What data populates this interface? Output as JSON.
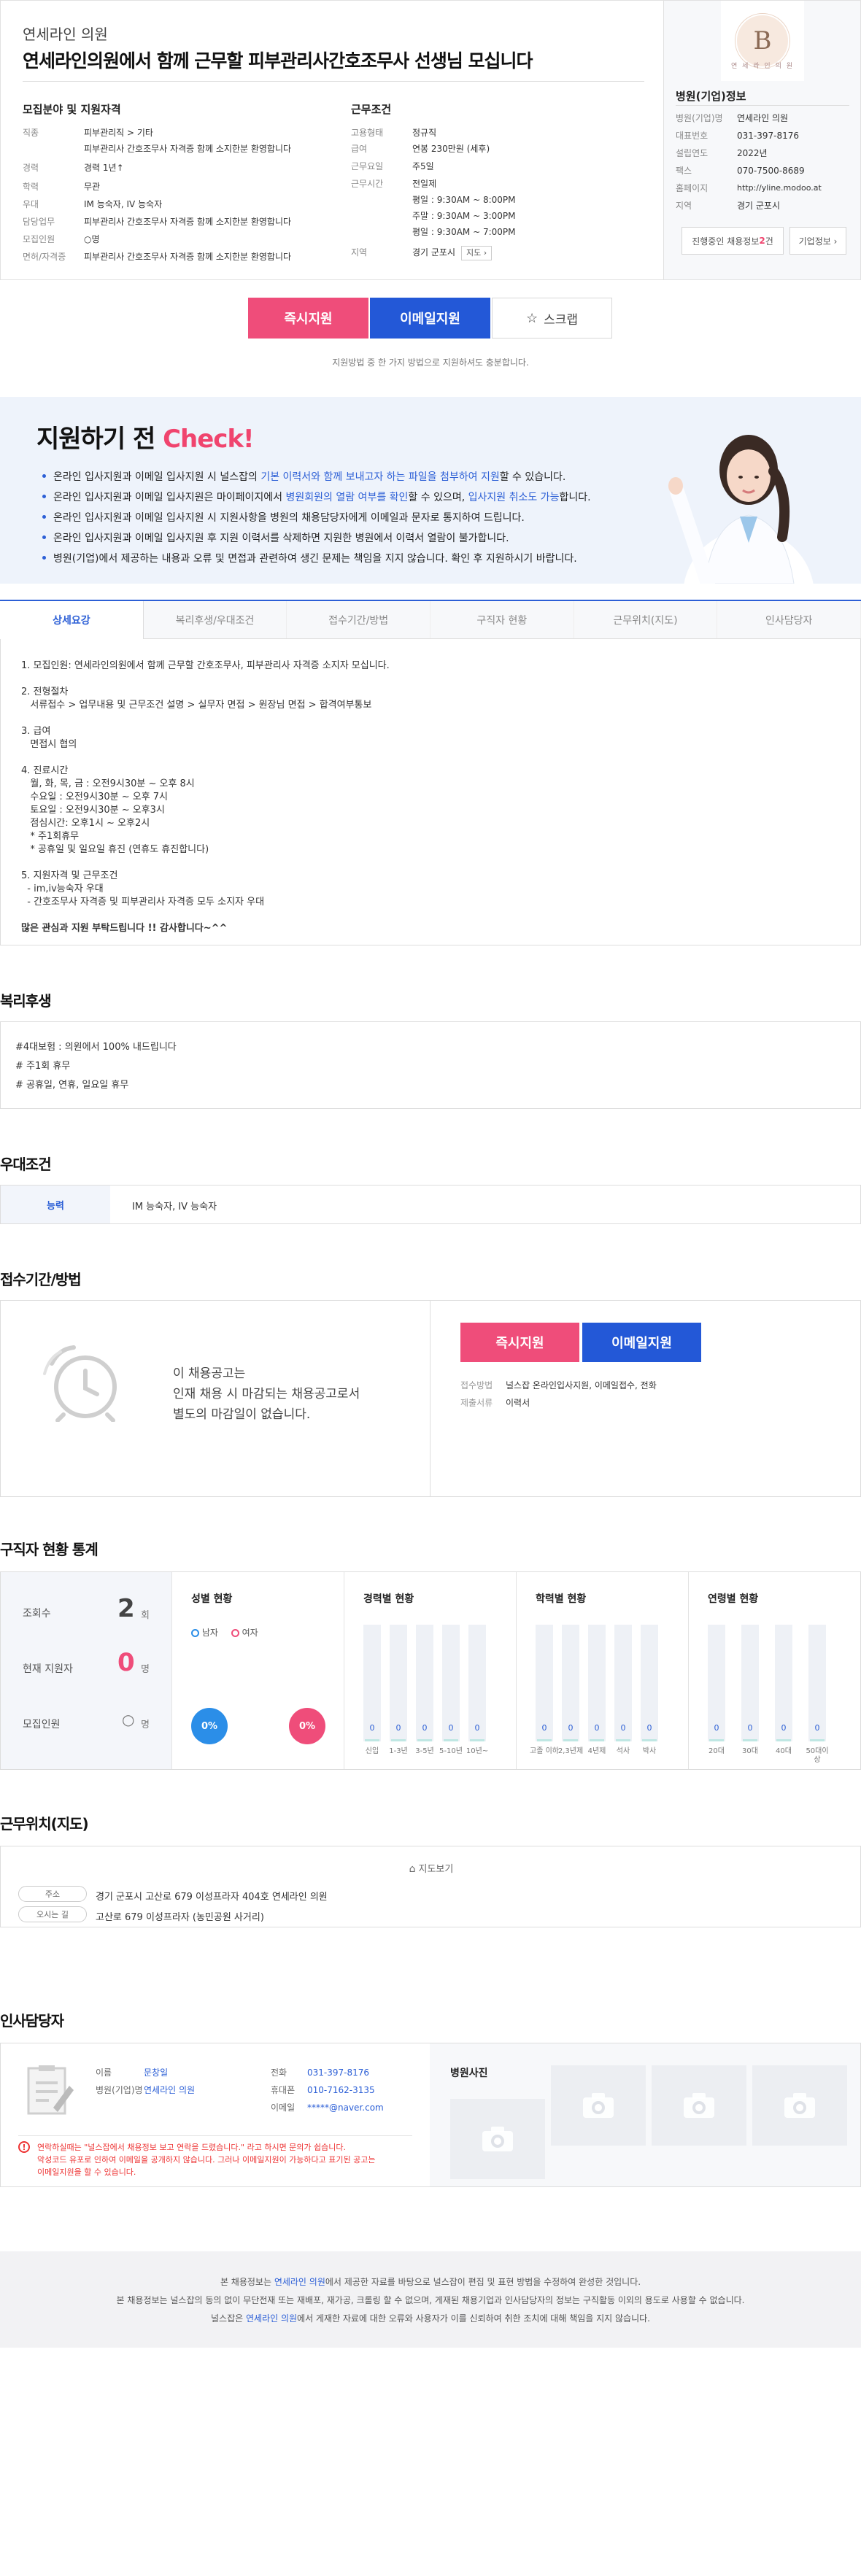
{
  "header": {
    "company": "연세라인 의원",
    "title": "연세라인의원에서 함께 근무할 피부관리사간호조무사 선생님 모십니다"
  },
  "req": {
    "heading": "모집분야 및 지원자격",
    "rows": [
      {
        "k": "직종",
        "v": "피부관리직 > 기타"
      },
      {
        "k": "",
        "v": "피부관리사 간호조무사 자격증 함께 소지한분 환영합니다"
      },
      {
        "k": "경력",
        "v": "경력 1년↑"
      },
      {
        "k": "학력",
        "v": "무관"
      },
      {
        "k": "우대",
        "v": "IM 능숙자, IV 능숙자"
      },
      {
        "k": "담당업무",
        "v": "피부관리사 간호조무사 자격증 함께 소지한분 환영합니다"
      },
      {
        "k": "모집인원",
        "v": "○명"
      },
      {
        "k": "면허/자격증",
        "v": "피부관리사 간호조무사 자격증 함께 소지한분 환영합니다"
      }
    ]
  },
  "cond": {
    "heading": "근무조건",
    "rows": [
      {
        "k": "고용형태",
        "v": "정규직"
      },
      {
        "k": "급여",
        "v": "연봉 230만원 (세후)"
      },
      {
        "k": "근무요일",
        "v": "주5일"
      },
      {
        "k": "근무시간",
        "v": "전일제"
      },
      {
        "k": "",
        "v": "평일 : 9:30AM ~ 8:00PM"
      },
      {
        "k": "",
        "v": "주말 : 9:30AM ~ 3:00PM"
      },
      {
        "k": "",
        "v": "평일 : 9:30AM ~ 7:00PM"
      }
    ],
    "location_label": "지역",
    "location": "경기 군포시",
    "map_btn": "지도 ›"
  },
  "hospital": {
    "logo_letter": "B",
    "logo_sub": "연 세 라 인 의 원",
    "heading": "병원(기업)정보",
    "rows": [
      {
        "k": "병원(기업)명",
        "v": "연세라인 의원"
      },
      {
        "k": "대표번호",
        "v": "031-397-8176"
      },
      {
        "k": "설립연도",
        "v": "2022년"
      },
      {
        "k": "팩스",
        "v": "070-7500-8689"
      },
      {
        "k": "홈페이지",
        "v": "http://yline.modoo.at"
      },
      {
        "k": "지역",
        "v": "경기 군포시"
      }
    ],
    "btn_jobs_pre": "진행중인 채용정보 ",
    "btn_jobs_count": "2",
    "btn_jobs_post": "건",
    "btn_company": "기업정보 ›"
  },
  "apply": {
    "now": "즉시지원",
    "email": "이메일지원",
    "scrap": "스크랩",
    "note": "지원방법 중 한 가지 방법으로 지원하셔도 충분합니다."
  },
  "check": {
    "title_pre": "지원하기 전 ",
    "title_hl": "Check!",
    "items": [
      {
        "a": "온라인 입사지원과 이메일 입사지원 시 널스잡의 ",
        "b": "기본 이력서와 함께 보내고자 하는 파일을 첨부하여 지원",
        "c": "할 수 있습니다.",
        "d": "",
        "e": ""
      },
      {
        "a": "온라인 입사지원과 이메일 입사지원은 마이페이지에서 ",
        "b": "병원회원의 열람 여부를 확인",
        "c": "할 수 있으며, ",
        "d": "입사지원 취소도 가능",
        "e": "합니다."
      },
      {
        "a": "온라인 입사지원과 이메일 입사지원 시 지원사항을 병원의 채용담당자에게 이메일과 문자로 통지하여 드립니다.",
        "b": "",
        "c": "",
        "d": "",
        "e": ""
      },
      {
        "a": "온라인 입사지원과 이메일 입사지원 후 지원 이력서를 삭제하면 지원한 병원에서 이력서 열람이 불가합니다.",
        "b": "",
        "c": "",
        "d": "",
        "e": ""
      },
      {
        "a": "병원(기업)에서 제공하는 내용과 오류 및 면접과 관련하여 생긴 문제는 책임을 지지 않습니다. 확인 후 지원하시기 바랍니다.",
        "b": "",
        "c": "",
        "d": "",
        "e": ""
      }
    ]
  },
  "tabs": [
    "상세요강",
    "복리후생/우대조건",
    "접수기간/방법",
    "구직자 현황",
    "근무위치(지도)",
    "인사담당자"
  ],
  "detail": {
    "text": "1. 모집인원: 연세라인의원에서 함께 근무할 간호조무사, 피부관리사 자격증 소지자 모십니다.\n\n2. 전형절차\n   서류접수 > 업무내용 및 근무조건 설명 > 실무자 면접 > 원장님 면접 > 합격여부통보\n\n3. 급여\n   면접시 협의\n\n4. 진료시간\n   월, 화, 목, 금 : 오전9시30분 ~ 오후 8시\n   수요일 : 오전9시30분 ~ 오후 7시\n   토요일 : 오전9시30분 ~ 오후3시\n   점심시간: 오후1시 ~ 오후2시\n   * 주1회휴무\n   * 공휴일 및 일요일 휴진 (연휴도 휴진합니다)\n\n5. 지원자격 및 근무조건\n  - im,iv능숙자 우대\n  - 간호조무사 자격증 및 피부관리사 자격증 모두 소지자 우대",
    "closing": "많은 관심과 지원 부탁드립니다 !! 감사합니다~^^"
  },
  "welfare": {
    "title": "복리후생",
    "items": [
      "#4대보험 : 의원에서 100% 내드립니다",
      "# 주1회 휴무",
      "# 공휴일, 연휴, 일요일 휴무"
    ]
  },
  "pref": {
    "title": "우대조건",
    "label": "능력",
    "value": "IM 능숙자, IV 능숙자"
  },
  "period": {
    "title": "접수기간/방법",
    "msg": [
      "이 채용공고는",
      "인재 채용 시 마감되는 채용공고로서",
      "별도의 마감일이 없습니다."
    ],
    "now": "즉시지원",
    "email": "이메일지원",
    "method_k": "접수방법",
    "method_v": "널스잡 온라인입사지원, 이메일접수, 전화",
    "docs_k": "제출서류",
    "docs_v": "이력서"
  },
  "stats": {
    "title": "구직자 현황 통계",
    "views_k": "조회수",
    "views_v": "2",
    "views_u": "회",
    "applicants_k": "현재 지원자",
    "applicants_v": "0",
    "applicants_u": "명",
    "recruit_k": "모집인원",
    "recruit_v": "○",
    "recruit_u": "명",
    "gender_h": "성별 현황",
    "male": "남자",
    "female": "여자",
    "male_pct": "0%",
    "female_pct": "0%",
    "career_h": "경력별 현황",
    "career": [
      {
        "l": "신입",
        "v": "0"
      },
      {
        "l": "1-3년",
        "v": "0"
      },
      {
        "l": "3-5년",
        "v": "0"
      },
      {
        "l": "5-10년",
        "v": "0"
      },
      {
        "l": "10년~",
        "v": "0"
      }
    ],
    "edu_h": "학력별 현황",
    "edu": [
      {
        "l": "고졸 이하",
        "v": "0"
      },
      {
        "l": "2,3년제",
        "v": "0"
      },
      {
        "l": "4년제",
        "v": "0"
      },
      {
        "l": "석사",
        "v": "0"
      },
      {
        "l": "박사",
        "v": "0"
      }
    ],
    "age_h": "연령별 현황",
    "age": [
      {
        "l": "20대",
        "v": "0"
      },
      {
        "l": "30대",
        "v": "0"
      },
      {
        "l": "40대",
        "v": "0"
      },
      {
        "l": "50대이상",
        "v": "0"
      }
    ]
  },
  "location": {
    "title": "근무위치(지도)",
    "map_btn": "지도보기",
    "addr_k": "주소",
    "addr_v": "경기 군포시 고산로 679 이성프라자 404호 연세라인 의원",
    "dir_k": "오시는 길",
    "dir_v": "고산로 679 이성프라자 (농민공원 사거리)"
  },
  "hr": {
    "title": "인사담당자",
    "name_k": "이름",
    "name_v": "문창일",
    "org_k": "병원(기업)명",
    "org_v": "연세라인 의원",
    "phone_k": "전화",
    "phone_v": "031-397-8176",
    "mobile_k": "휴대폰",
    "mobile_v": "010-7162-3135",
    "email_k": "이메일",
    "email_v": "*****@naver.com",
    "notice_1": "연락하실때는 \"널스잡에서 채용정보 보고 연락을 드렸습니다.\" 라고 하시면 문의가 쉽습니다.",
    "notice_2": "악성코드 유포로 인하여 이메일을 공개하지 않습니다. 그러나 이메일지원이 가능하다고 표기된 공고는",
    "notice_3": "이메일지원을 할 수 있습니다.",
    "photo_title": "병원사진"
  },
  "footer": {
    "l1_a": "본 채용정보는 ",
    "l1_b": "연세라인 의원",
    "l1_c": "에서 제공한 자료를 바탕으로 널스잡이 편집 및 표현 방법을 수정하여 완성한 것입니다.",
    "l2": "본 채용정보는 널스잡의 동의 없이 무단전재 또는 재배포, 재가공, 크롤링 할 수 없으며, 게재된 채용기업과 인사담당자의 정보는 구직활동 이외의 용도로 사용할 수 없습니다.",
    "l3_a": "널스잡은 ",
    "l3_b": "연세라인 의원",
    "l3_c": "에서 게재한 자료에 대한 오류와 사용자가 이를 신뢰하여 취한 조치에 대해 책임을 지지 않습니다."
  },
  "colors": {
    "brand_blue": "#2358d7",
    "brand_red": "#ef4d7a",
    "link_blue": "#2c5fd6"
  }
}
